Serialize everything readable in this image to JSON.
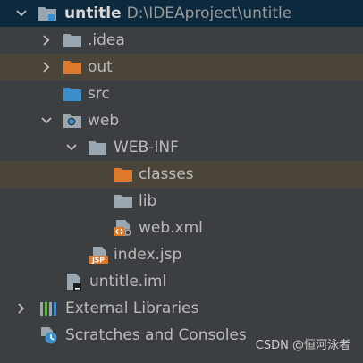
{
  "tree": {
    "root": {
      "name": "untitle",
      "path": "D:\\IDEAproject\\untitle"
    },
    "idea": "idea",
    "idea_dot": ".",
    "out": "out",
    "src": "src",
    "web": "web",
    "webinf": "WEB-INF",
    "classes": "classes",
    "lib": "lib",
    "webxml": "web.xml",
    "indexjsp": "index.jsp",
    "iml": "untitle.iml",
    "external": "External Libraries",
    "scratches": "Scratches and Consoles",
    "jsp_badge": "JSP"
  },
  "watermark": "CSDN @恒河泳者",
  "colors": {
    "background": "#3c3f41",
    "root_selection": "#0d293e",
    "highlight_row": "#4b4439",
    "folder_gray": "#9aa7b0",
    "folder_orange": "#e07a2b",
    "folder_blue": "#3b8ec9"
  },
  "icons": [
    "module-folder-icon",
    "folder-icon",
    "excluded-folder-icon",
    "source-folder-icon",
    "web-folder-icon",
    "xml-file-icon",
    "jsp-file-icon",
    "iml-file-icon",
    "libraries-icon",
    "scratches-icon"
  ]
}
